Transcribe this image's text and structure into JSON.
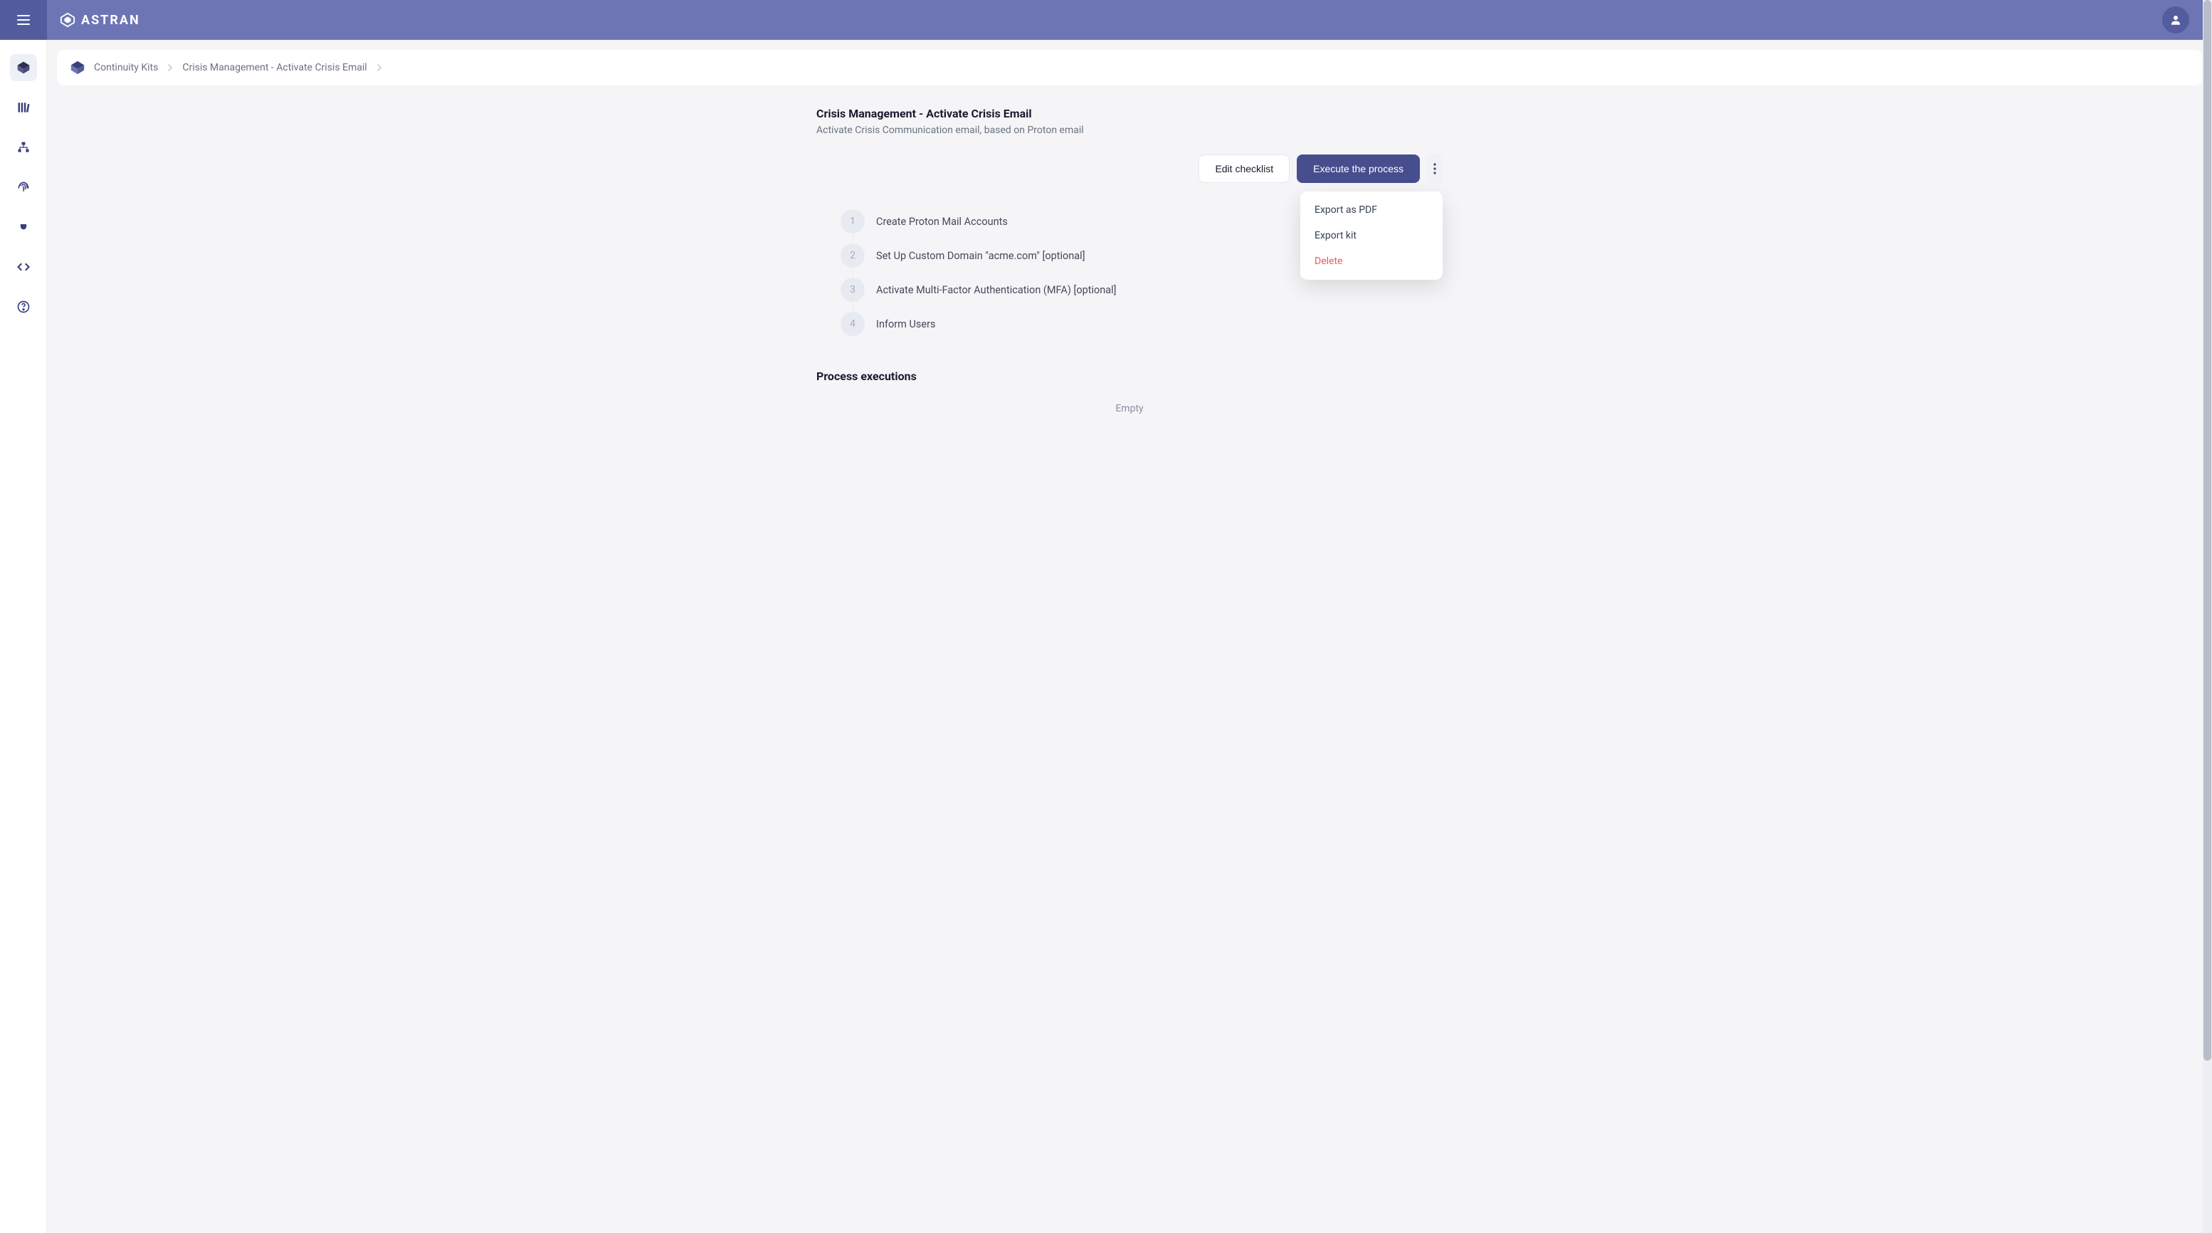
{
  "brand": {
    "name": "ASTRAN"
  },
  "breadcrumbs": {
    "items": [
      "Continuity Kits",
      "Crisis Management - Activate Crisis Email"
    ]
  },
  "page": {
    "title": "Crisis Management - Activate Crisis Email",
    "description": "Activate Crisis Communication email, based on Proton email"
  },
  "actions": {
    "edit_label": "Edit checklist",
    "execute_label": "Execute the process"
  },
  "dropdown": {
    "export_pdf": "Export as PDF",
    "export_kit": "Export kit",
    "delete": "Delete"
  },
  "steps": [
    {
      "num": "1",
      "label": "Create Proton Mail Accounts"
    },
    {
      "num": "2",
      "label": "Set Up Custom Domain \"acme.com\" [optional]"
    },
    {
      "num": "3",
      "label": "Activate Multi-Factor Authentication (MFA) [optional]"
    },
    {
      "num": "4",
      "label": "Inform Users"
    }
  ],
  "executions": {
    "title": "Process executions",
    "empty": "Empty"
  },
  "sidebar_icons": [
    "cube-icon",
    "library-icon",
    "org-icon",
    "fingerprint-icon",
    "plug-icon",
    "code-icon",
    "help-icon"
  ]
}
